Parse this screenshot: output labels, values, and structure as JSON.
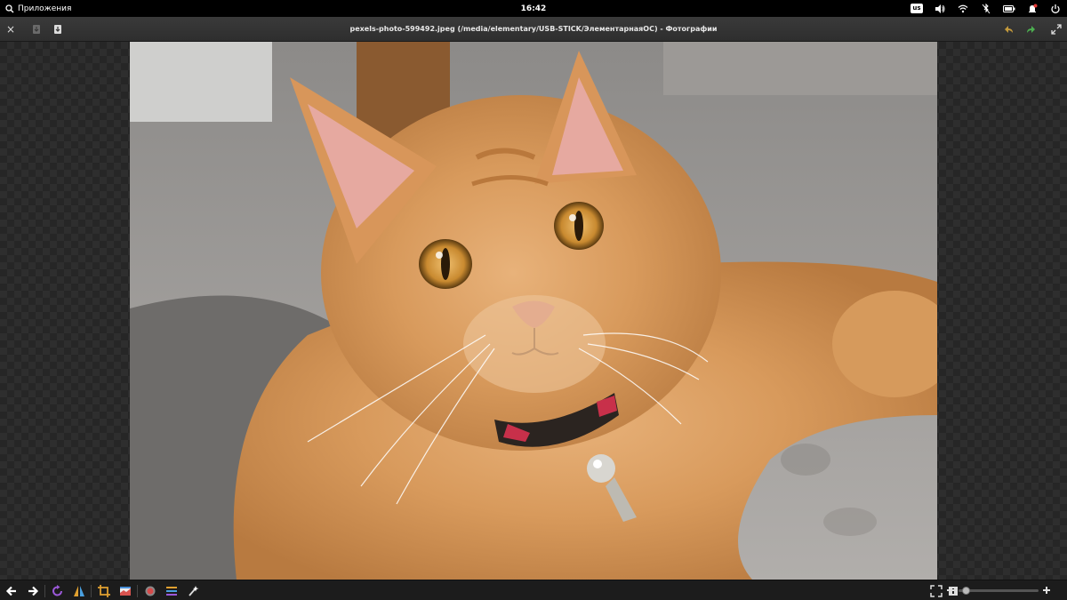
{
  "system_panel": {
    "apps_label": "Приложения",
    "clock": "16:42",
    "keyboard_layout": "us",
    "icons": [
      "volume-icon",
      "wifi-icon",
      "mic-muted-icon",
      "battery-icon",
      "notifications-icon",
      "power-icon"
    ]
  },
  "window": {
    "title": "pexels-photo-599492.jpeg (/media/elementary/USB-STICK/ЭлементарнаяОС) - Фотографии",
    "close_label": "×",
    "accent_undo": "#c49a3c",
    "accent_redo": "#4caf50"
  },
  "zoom": {
    "level": 0.05
  },
  "colors": {
    "panel_bg": "#000000",
    "header_bg": "#333333",
    "toolbar_bg": "#1c1c1c",
    "rotate": "#9b59d9",
    "red_eye": "#d64a4a"
  }
}
